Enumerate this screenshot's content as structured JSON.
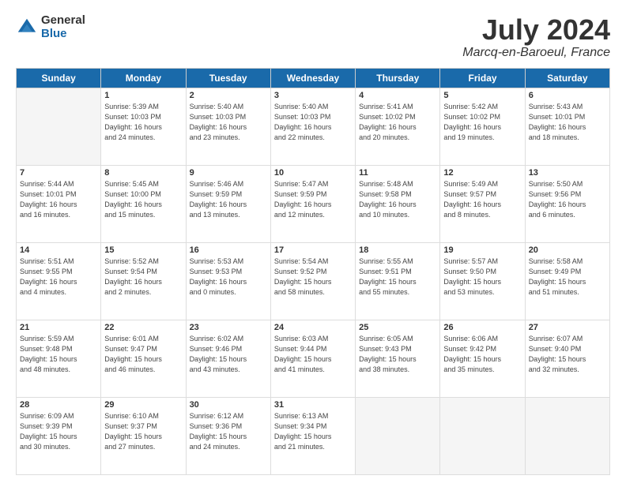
{
  "header": {
    "logo_general": "General",
    "logo_blue": "Blue",
    "title": "July 2024",
    "location": "Marcq-en-Baroeul, France"
  },
  "days_of_week": [
    "Sunday",
    "Monday",
    "Tuesday",
    "Wednesday",
    "Thursday",
    "Friday",
    "Saturday"
  ],
  "weeks": [
    [
      {
        "day": "",
        "info": ""
      },
      {
        "day": "1",
        "info": "Sunrise: 5:39 AM\nSunset: 10:03 PM\nDaylight: 16 hours\nand 24 minutes."
      },
      {
        "day": "2",
        "info": "Sunrise: 5:40 AM\nSunset: 10:03 PM\nDaylight: 16 hours\nand 23 minutes."
      },
      {
        "day": "3",
        "info": "Sunrise: 5:40 AM\nSunset: 10:03 PM\nDaylight: 16 hours\nand 22 minutes."
      },
      {
        "day": "4",
        "info": "Sunrise: 5:41 AM\nSunset: 10:02 PM\nDaylight: 16 hours\nand 20 minutes."
      },
      {
        "day": "5",
        "info": "Sunrise: 5:42 AM\nSunset: 10:02 PM\nDaylight: 16 hours\nand 19 minutes."
      },
      {
        "day": "6",
        "info": "Sunrise: 5:43 AM\nSunset: 10:01 PM\nDaylight: 16 hours\nand 18 minutes."
      }
    ],
    [
      {
        "day": "7",
        "info": "Sunrise: 5:44 AM\nSunset: 10:01 PM\nDaylight: 16 hours\nand 16 minutes."
      },
      {
        "day": "8",
        "info": "Sunrise: 5:45 AM\nSunset: 10:00 PM\nDaylight: 16 hours\nand 15 minutes."
      },
      {
        "day": "9",
        "info": "Sunrise: 5:46 AM\nSunset: 9:59 PM\nDaylight: 16 hours\nand 13 minutes."
      },
      {
        "day": "10",
        "info": "Sunrise: 5:47 AM\nSunset: 9:59 PM\nDaylight: 16 hours\nand 12 minutes."
      },
      {
        "day": "11",
        "info": "Sunrise: 5:48 AM\nSunset: 9:58 PM\nDaylight: 16 hours\nand 10 minutes."
      },
      {
        "day": "12",
        "info": "Sunrise: 5:49 AM\nSunset: 9:57 PM\nDaylight: 16 hours\nand 8 minutes."
      },
      {
        "day": "13",
        "info": "Sunrise: 5:50 AM\nSunset: 9:56 PM\nDaylight: 16 hours\nand 6 minutes."
      }
    ],
    [
      {
        "day": "14",
        "info": "Sunrise: 5:51 AM\nSunset: 9:55 PM\nDaylight: 16 hours\nand 4 minutes."
      },
      {
        "day": "15",
        "info": "Sunrise: 5:52 AM\nSunset: 9:54 PM\nDaylight: 16 hours\nand 2 minutes."
      },
      {
        "day": "16",
        "info": "Sunrise: 5:53 AM\nSunset: 9:53 PM\nDaylight: 16 hours\nand 0 minutes."
      },
      {
        "day": "17",
        "info": "Sunrise: 5:54 AM\nSunset: 9:52 PM\nDaylight: 15 hours\nand 58 minutes."
      },
      {
        "day": "18",
        "info": "Sunrise: 5:55 AM\nSunset: 9:51 PM\nDaylight: 15 hours\nand 55 minutes."
      },
      {
        "day": "19",
        "info": "Sunrise: 5:57 AM\nSunset: 9:50 PM\nDaylight: 15 hours\nand 53 minutes."
      },
      {
        "day": "20",
        "info": "Sunrise: 5:58 AM\nSunset: 9:49 PM\nDaylight: 15 hours\nand 51 minutes."
      }
    ],
    [
      {
        "day": "21",
        "info": "Sunrise: 5:59 AM\nSunset: 9:48 PM\nDaylight: 15 hours\nand 48 minutes."
      },
      {
        "day": "22",
        "info": "Sunrise: 6:01 AM\nSunset: 9:47 PM\nDaylight: 15 hours\nand 46 minutes."
      },
      {
        "day": "23",
        "info": "Sunrise: 6:02 AM\nSunset: 9:46 PM\nDaylight: 15 hours\nand 43 minutes."
      },
      {
        "day": "24",
        "info": "Sunrise: 6:03 AM\nSunset: 9:44 PM\nDaylight: 15 hours\nand 41 minutes."
      },
      {
        "day": "25",
        "info": "Sunrise: 6:05 AM\nSunset: 9:43 PM\nDaylight: 15 hours\nand 38 minutes."
      },
      {
        "day": "26",
        "info": "Sunrise: 6:06 AM\nSunset: 9:42 PM\nDaylight: 15 hours\nand 35 minutes."
      },
      {
        "day": "27",
        "info": "Sunrise: 6:07 AM\nSunset: 9:40 PM\nDaylight: 15 hours\nand 32 minutes."
      }
    ],
    [
      {
        "day": "28",
        "info": "Sunrise: 6:09 AM\nSunset: 9:39 PM\nDaylight: 15 hours\nand 30 minutes."
      },
      {
        "day": "29",
        "info": "Sunrise: 6:10 AM\nSunset: 9:37 PM\nDaylight: 15 hours\nand 27 minutes."
      },
      {
        "day": "30",
        "info": "Sunrise: 6:12 AM\nSunset: 9:36 PM\nDaylight: 15 hours\nand 24 minutes."
      },
      {
        "day": "31",
        "info": "Sunrise: 6:13 AM\nSunset: 9:34 PM\nDaylight: 15 hours\nand 21 minutes."
      },
      {
        "day": "",
        "info": ""
      },
      {
        "day": "",
        "info": ""
      },
      {
        "day": "",
        "info": ""
      }
    ]
  ]
}
